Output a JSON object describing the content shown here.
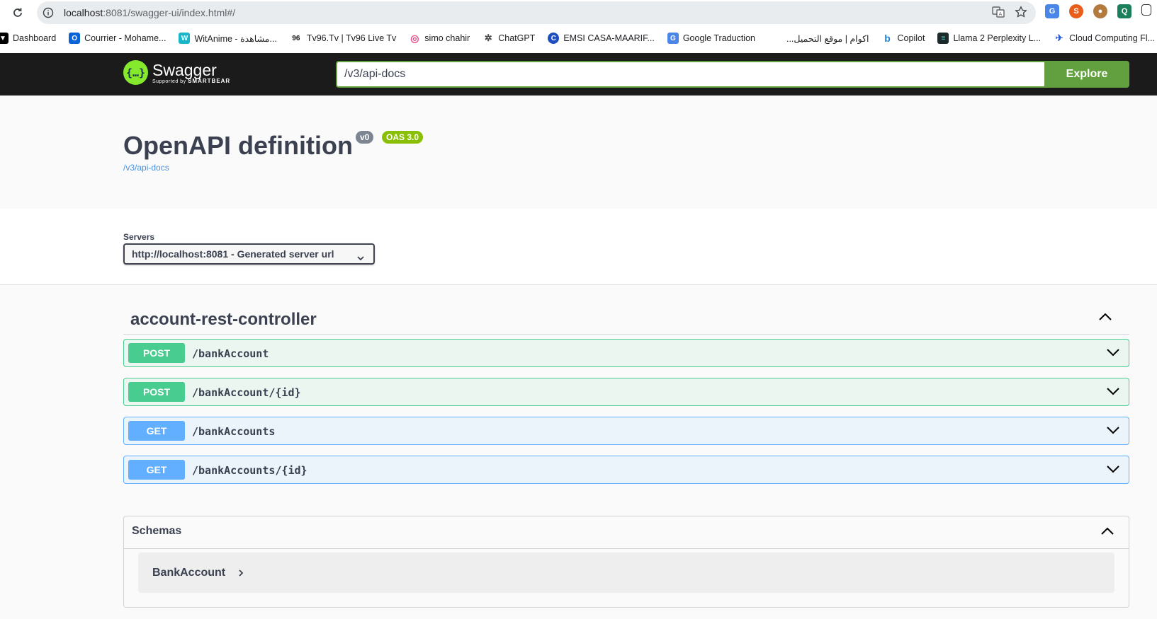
{
  "browser": {
    "url_host": "localhost",
    "url_rest": ":8081/swagger-ui/index.html#/",
    "bookmarks": [
      {
        "label": "Dashboard",
        "icon": "vercel-icon",
        "color": "#000000",
        "glyph": "▼"
      },
      {
        "label": "Courrier - Mohame...",
        "icon": "outlook-icon",
        "color": "#0a64d8",
        "glyph": "O"
      },
      {
        "label": "WitAnime - مشاهدة...",
        "icon": "witanime-icon",
        "color": "#19b5c9",
        "glyph": "W"
      },
      {
        "label": "Tv96.Tv | Tv96 Live Tv",
        "icon": "tv96-icon",
        "color": "#111111",
        "glyph": "96"
      },
      {
        "label": "simo chahir",
        "icon": "pinwheel-icon",
        "color": "#e94b8a",
        "glyph": "◎"
      },
      {
        "label": "ChatGPT",
        "icon": "chatgpt-icon",
        "color": "#444444",
        "glyph": "✲"
      },
      {
        "label": "EMSI CASA-MAARIF...",
        "icon": "emsi-icon",
        "color": "#1f4fbf",
        "glyph": "C"
      },
      {
        "label": "Google Traduction",
        "icon": "google-translate-icon",
        "color": "#4a86e8",
        "glyph": "G"
      },
      {
        "label": "اكوام | موقع التحميل...",
        "icon": "akwam-icon",
        "color": "#ffffff",
        "glyph": ""
      },
      {
        "label": "Copilot",
        "icon": "bing-icon",
        "color": "#1e7fd6",
        "glyph": "b"
      },
      {
        "label": "Llama 2 Perplexity L...",
        "icon": "perplexity-icon",
        "color": "#1b2b2b",
        "glyph": "≡"
      },
      {
        "label": "Cloud Computing Fl...",
        "icon": "cloud-icon",
        "color": "#2a5bd7",
        "glyph": "✈"
      }
    ]
  },
  "swagger": {
    "brand": "Swagger",
    "brand_sub_pre": "Supported by ",
    "brand_sub": "SMARTBEAR",
    "spec_url": "/v3/api-docs",
    "explore_label": "Explore"
  },
  "info": {
    "title": "OpenAPI definition",
    "version": "v0",
    "oas": "OAS 3.0",
    "link": "/v3/api-docs"
  },
  "servers": {
    "label": "Servers",
    "selected": "http://localhost:8081 - Generated server url"
  },
  "tag": {
    "name": "account-rest-controller",
    "operations": [
      {
        "method": "POST",
        "path": "/bankAccount"
      },
      {
        "method": "POST",
        "path": "/bankAccount/{id}"
      },
      {
        "method": "GET",
        "path": "/bankAccounts"
      },
      {
        "method": "GET",
        "path": "/bankAccounts/{id}"
      }
    ]
  },
  "schemas": {
    "title": "Schemas",
    "models": [
      "BankAccount"
    ]
  },
  "colors": {
    "post": "#49cc90",
    "get": "#61affe",
    "topbar": "#1b1b1b",
    "explore": "#62a03f"
  }
}
